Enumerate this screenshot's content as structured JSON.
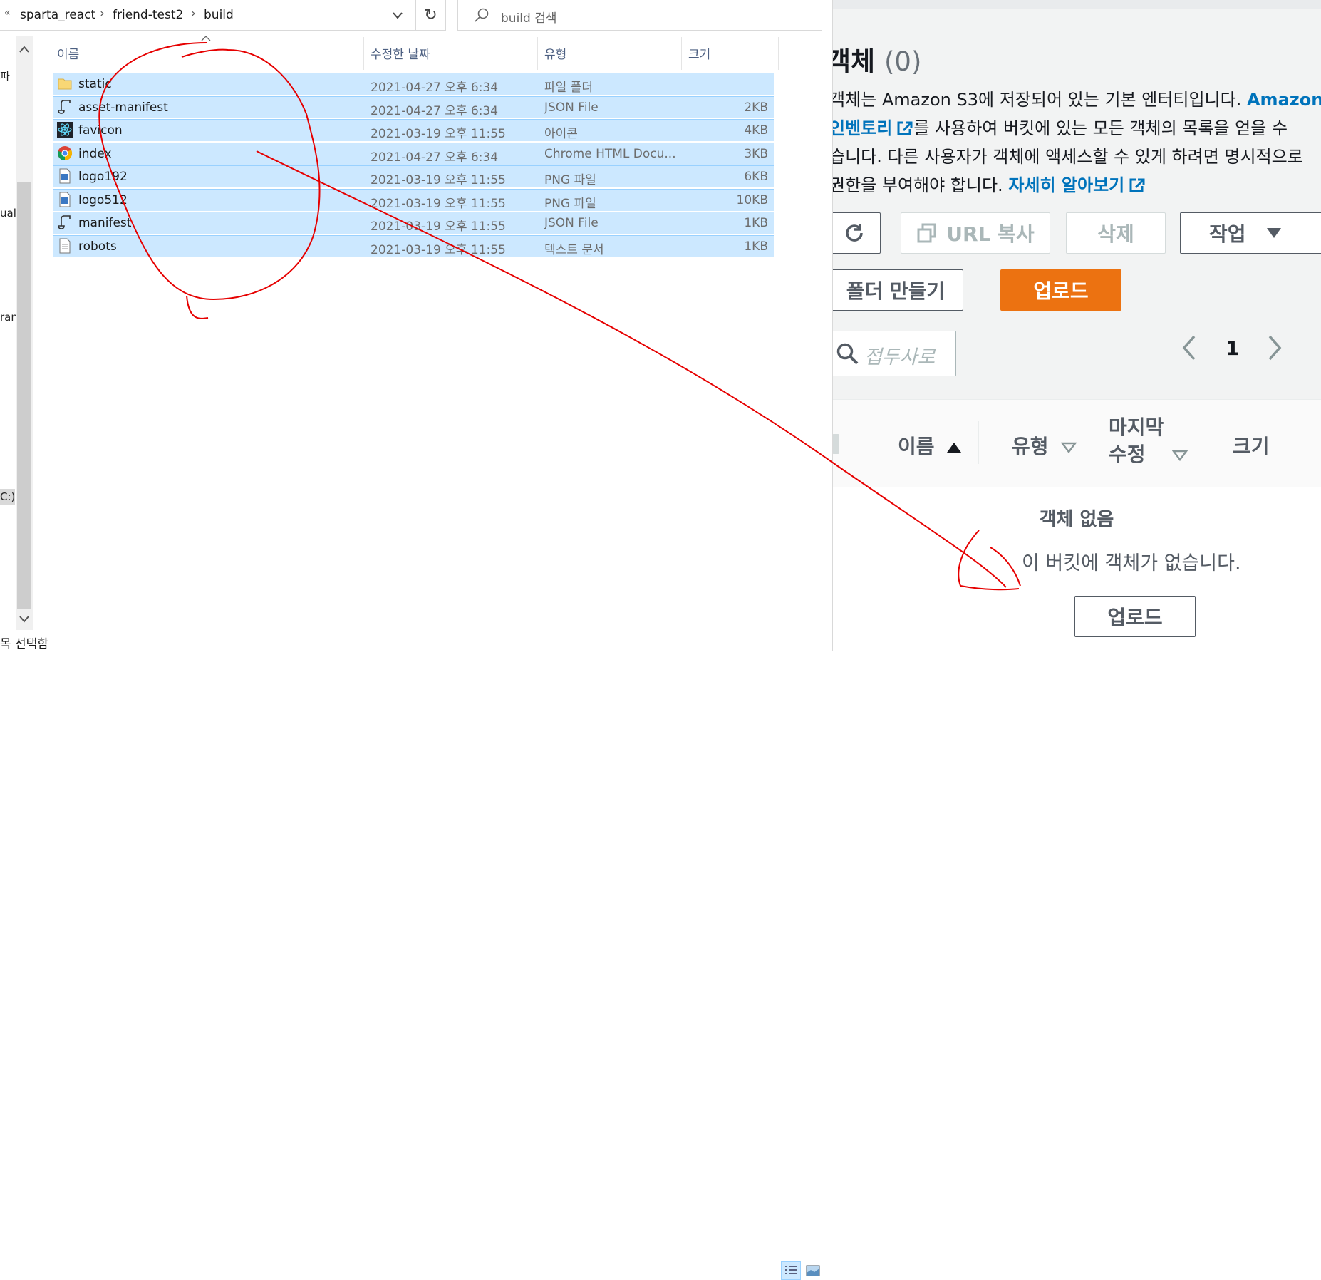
{
  "explorer": {
    "breadcrumb": [
      "sparta_react",
      "friend-test2",
      "build"
    ],
    "search_placeholder": "build 검색",
    "columns": {
      "name": "이름",
      "date": "수정한 날짜",
      "type": "유형",
      "size": "크기"
    },
    "files": [
      {
        "name": "static",
        "date": "2021-04-27 오후 6:34",
        "type": "파일 폴더",
        "size": "",
        "icon": "folder-icon"
      },
      {
        "name": "asset-manifest",
        "date": "2021-04-27 오후 6:34",
        "type": "JSON File",
        "size": "2KB",
        "icon": "json-file-icon"
      },
      {
        "name": "favicon",
        "date": "2021-03-19 오후 11:55",
        "type": "아이콘",
        "size": "4KB",
        "icon": "react-icon"
      },
      {
        "name": "index",
        "date": "2021-04-27 오후 6:34",
        "type": "Chrome HTML Docu...",
        "size": "3KB",
        "icon": "chrome-icon"
      },
      {
        "name": "logo192",
        "date": "2021-03-19 오후 11:55",
        "type": "PNG 파일",
        "size": "6KB",
        "icon": "image-file-icon"
      },
      {
        "name": "logo512",
        "date": "2021-03-19 오후 11:55",
        "type": "PNG 파일",
        "size": "10KB",
        "icon": "image-file-icon"
      },
      {
        "name": "manifest",
        "date": "2021-03-19 오후 11:55",
        "type": "JSON File",
        "size": "1KB",
        "icon": "json-file-icon"
      },
      {
        "name": "robots",
        "date": "2021-03-19 오후 11:55",
        "type": "텍스트 문서",
        "size": "1KB",
        "icon": "text-file-icon"
      }
    ],
    "nav_fragments": [
      "파",
      "ual",
      "ran",
      "C:)"
    ],
    "status_text": "목 선택함"
  },
  "s3": {
    "title": "객체",
    "count": "(0)",
    "desc_line1_a": "객체는 Amazon S3에 저장되어 있는 기본 엔터티입니다. ",
    "desc_line1_link": "Amazon S",
    "desc_line2_link": "인벤토리",
    "desc_line2_b": "를 사용하여 버킷에 있는 모든 객체의 목록을 얻을 수",
    "desc_line3": "습니다. 다른 사용자가 객체에 액세스할 수 있게 하려면 명시적으로",
    "desc_line4_a": "권한을 부여해야 합니다. ",
    "desc_line4_link": "자세히 알아보기",
    "buttons": {
      "copy_url": "URL 복사",
      "delete": "삭제",
      "actions": "작업",
      "create_folder": "폴더 만들기",
      "upload": "업로드"
    },
    "search_placeholder": "접두사로",
    "page_number": "1",
    "table_headers": {
      "name": "이름",
      "type": "유형",
      "modified_1": "마지막",
      "modified_2": "수정",
      "size": "크기"
    },
    "empty_title": "객체 없음",
    "empty_desc": "이 버킷에 객체가 없습니다.",
    "empty_upload": "업로드"
  },
  "colors": {
    "selection": "#cce8ff",
    "aws_orange": "#ec7211",
    "aws_link": "#0073bb",
    "annotation": "#e60000"
  }
}
